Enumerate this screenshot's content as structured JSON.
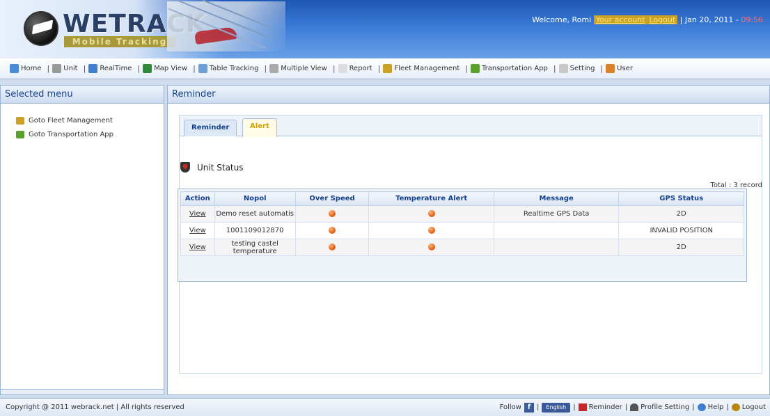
{
  "header": {
    "logo_title": "WETRACK",
    "logo_subtitle": "Mobile Tracking",
    "welcome_prefix": "Welcome, Romi",
    "your_account": "Your account",
    "logout": "Logout",
    "date": "Jan 20, 2011",
    "time": "09:56"
  },
  "nav": {
    "items": [
      {
        "label": "Home",
        "icon": "home-icon",
        "color": "#4a8ad8"
      },
      {
        "label": "Unit",
        "icon": "unit-icon",
        "color": "#999999"
      },
      {
        "label": "RealTime",
        "icon": "realtime-icon",
        "color": "#3f7fd1"
      },
      {
        "label": "Map View",
        "icon": "globe-icon",
        "color": "#2e8b3a"
      },
      {
        "label": "Table Tracking",
        "icon": "table-icon",
        "color": "#6ca0d8"
      },
      {
        "label": "Multiple View",
        "icon": "multiple-view-icon",
        "color": "#aaaaaa"
      },
      {
        "label": "Report",
        "icon": "report-icon",
        "color": "#dddddd"
      },
      {
        "label": "Fleet Management",
        "icon": "fleet-icon",
        "color": "#c9a227"
      },
      {
        "label": "Transportation App",
        "icon": "transport-icon",
        "color": "#5aa02c"
      },
      {
        "label": "Setting",
        "icon": "setting-icon",
        "color": "#c8c8c8"
      },
      {
        "label": "User",
        "icon": "user-icon",
        "color": "#d9822b"
      }
    ]
  },
  "left_panel": {
    "title": "Selected menu",
    "items": [
      {
        "label": "Goto Fleet Management",
        "icon": "fleet-icon",
        "color": "#c9a227"
      },
      {
        "label": "Goto Transportation App",
        "icon": "transport-icon",
        "color": "#5aa02c"
      }
    ]
  },
  "main_panel": {
    "title": "Reminder",
    "tabs": [
      {
        "label": "Reminder"
      },
      {
        "label": "Alert"
      }
    ],
    "section_title": "Unit Status",
    "total": "Total : 3 record",
    "columns": [
      "Action",
      "Nopol",
      "Over Speed",
      "Temperature Alert",
      "Message",
      "GPS Status"
    ],
    "rows": [
      {
        "action": "View",
        "nopol": "Demo reset automatis",
        "message": "Realtime GPS Data",
        "gps": "2D"
      },
      {
        "action": "View",
        "nopol": "1001109012870",
        "message": "",
        "gps": "INVALID POSITION"
      },
      {
        "action": "View",
        "nopol": "testing castel temperature",
        "message": "",
        "gps": "2D"
      }
    ]
  },
  "footer": {
    "copyright": "Copyright @ 2011 webrack.net | All rights reserved",
    "follow": "Follow",
    "fb_badge": "English",
    "reminder": "Reminder",
    "profile_setting": "Profile Setting",
    "help": "Help",
    "logout": "Logout"
  }
}
